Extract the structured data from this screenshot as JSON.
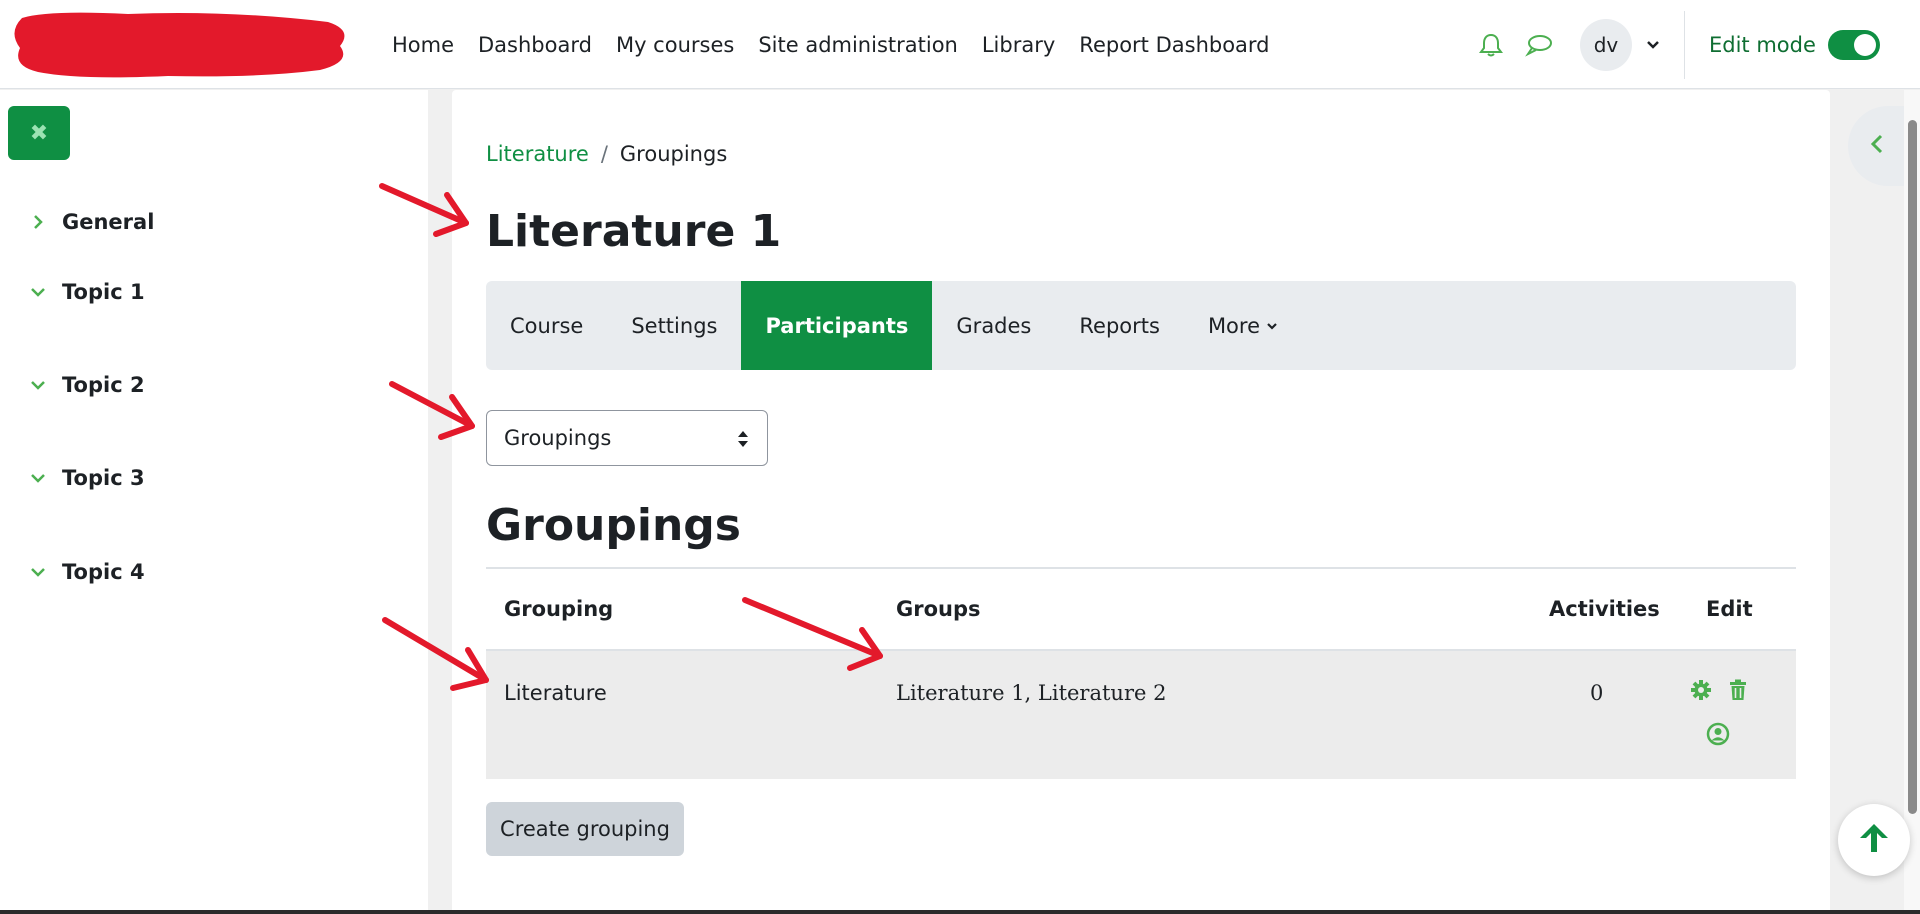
{
  "nav": {
    "links": [
      "Home",
      "Dashboard",
      "My courses",
      "Site administration",
      "Library",
      "Report Dashboard"
    ],
    "user_initials": "dv",
    "edit_mode_label": "Edit mode"
  },
  "drawer": {
    "items": [
      {
        "label": "General",
        "state": "collapsed"
      },
      {
        "label": "Topic 1",
        "state": "expanded"
      },
      {
        "label": "Topic 2",
        "state": "expanded"
      },
      {
        "label": "Topic 3",
        "state": "expanded"
      },
      {
        "label": "Topic 4",
        "state": "expanded"
      }
    ]
  },
  "breadcrumb": {
    "course": "Literature",
    "separator": "/",
    "current": "Groupings"
  },
  "page_title": "Literature 1",
  "tabs": {
    "course": "Course",
    "settings": "Settings",
    "participants": "Participants",
    "grades": "Grades",
    "reports": "Reports",
    "more": "More"
  },
  "select": {
    "value": "Groupings"
  },
  "section_title": "Groupings",
  "table": {
    "headers": {
      "grouping": "Grouping",
      "groups": "Groups",
      "activities": "Activities",
      "edit": "Edit"
    },
    "rows": [
      {
        "grouping": "Literature",
        "groups": "Literature 1, Literature 2",
        "activities": "0"
      }
    ]
  },
  "buttons": {
    "create_grouping": "Create grouping"
  },
  "colors": {
    "brand": "#0f8f43",
    "annotation": "#e3192b"
  }
}
